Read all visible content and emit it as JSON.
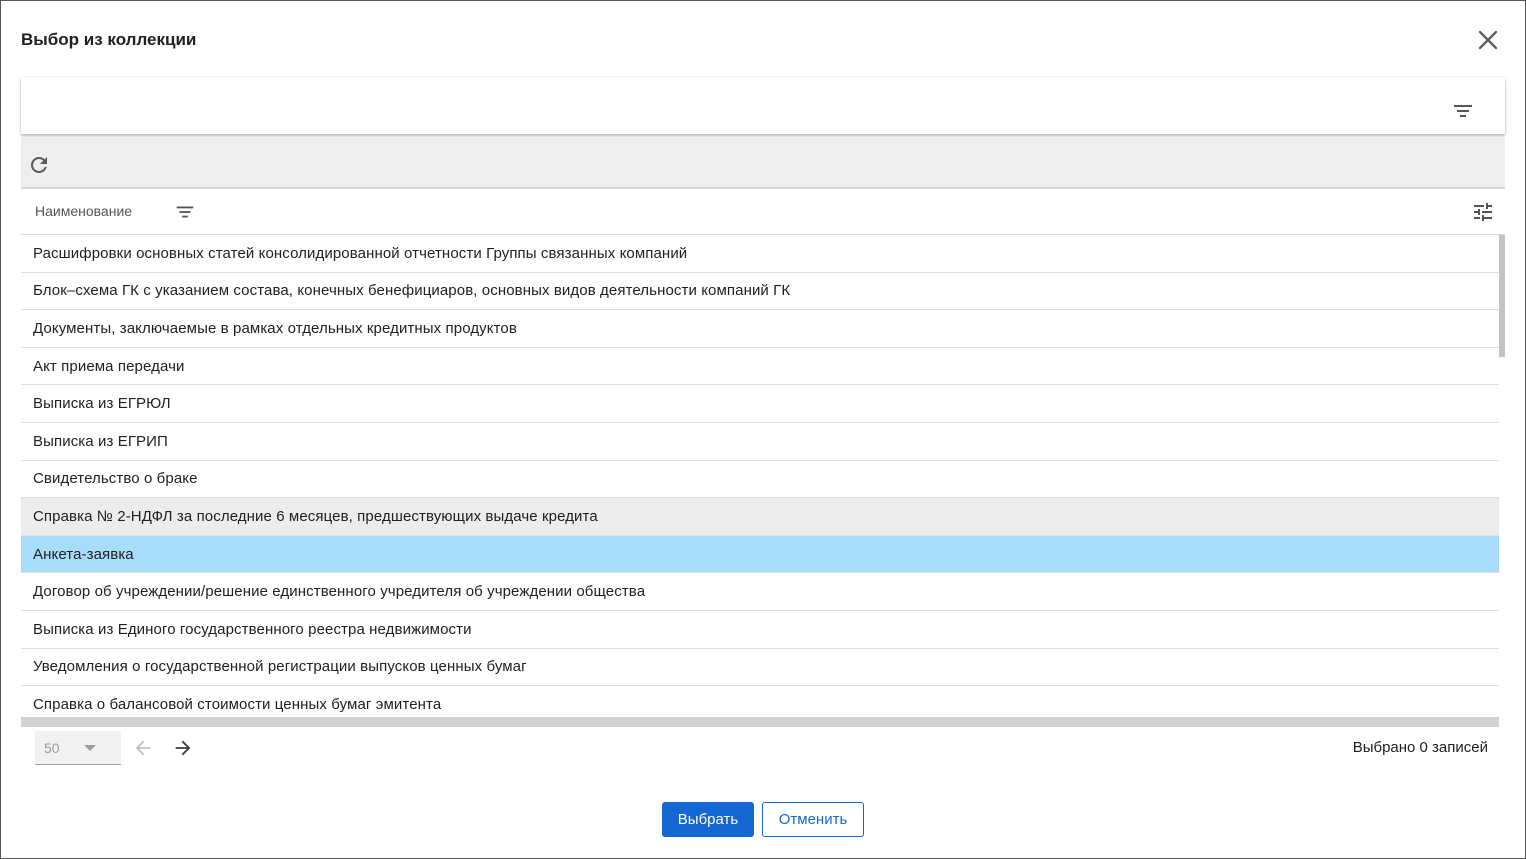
{
  "dialog": {
    "title": "Выбор из коллекции"
  },
  "icons": {
    "close": "close-icon",
    "filter": "filter-icon",
    "refresh": "refresh-icon",
    "column_settings": "tune-icon",
    "prev": "arrow-left-icon",
    "next": "arrow-right-icon"
  },
  "table": {
    "column_header": "Наименование",
    "rows": [
      "Расшифровки основных статей консолидированной отчетности Группы связанных компаний",
      "Блок–схема ГК с указанием состава, конечных бенефициаров, основных видов деятельности компаний ГК",
      "Документы, заключаемые в рамках отдельных кредитных продуктов",
      "Акт приема передачи",
      "Выписка из ЕГРЮЛ",
      "Выписка из ЕГРИП",
      "Свидетельство о браке",
      "Справка № 2-НДФЛ за последние 6 месяцев, предшествующих выдаче кредита",
      "Анкета-заявка",
      "Договор об учреждении/решение единственного учредителя об учреждении общества",
      "Выписка из Единого государственного реестра недвижимости",
      "Уведомления о государственной регистрации выпусков ценных бумаг",
      "Справка о балансовой стоимости ценных бумаг эмитента"
    ],
    "hover_row_index": 7,
    "selected_row_index": 8
  },
  "pager": {
    "page_size": "50",
    "selected_count_text": "Выбрано 0 записей"
  },
  "actions": {
    "select_label": "Выбрать",
    "cancel_label": "Отменить"
  },
  "colors": {
    "accent": "#1467d2",
    "selected_row": "#a8dcfb",
    "hover_row": "#ececec",
    "toolbar_bg": "#eeeeee"
  }
}
